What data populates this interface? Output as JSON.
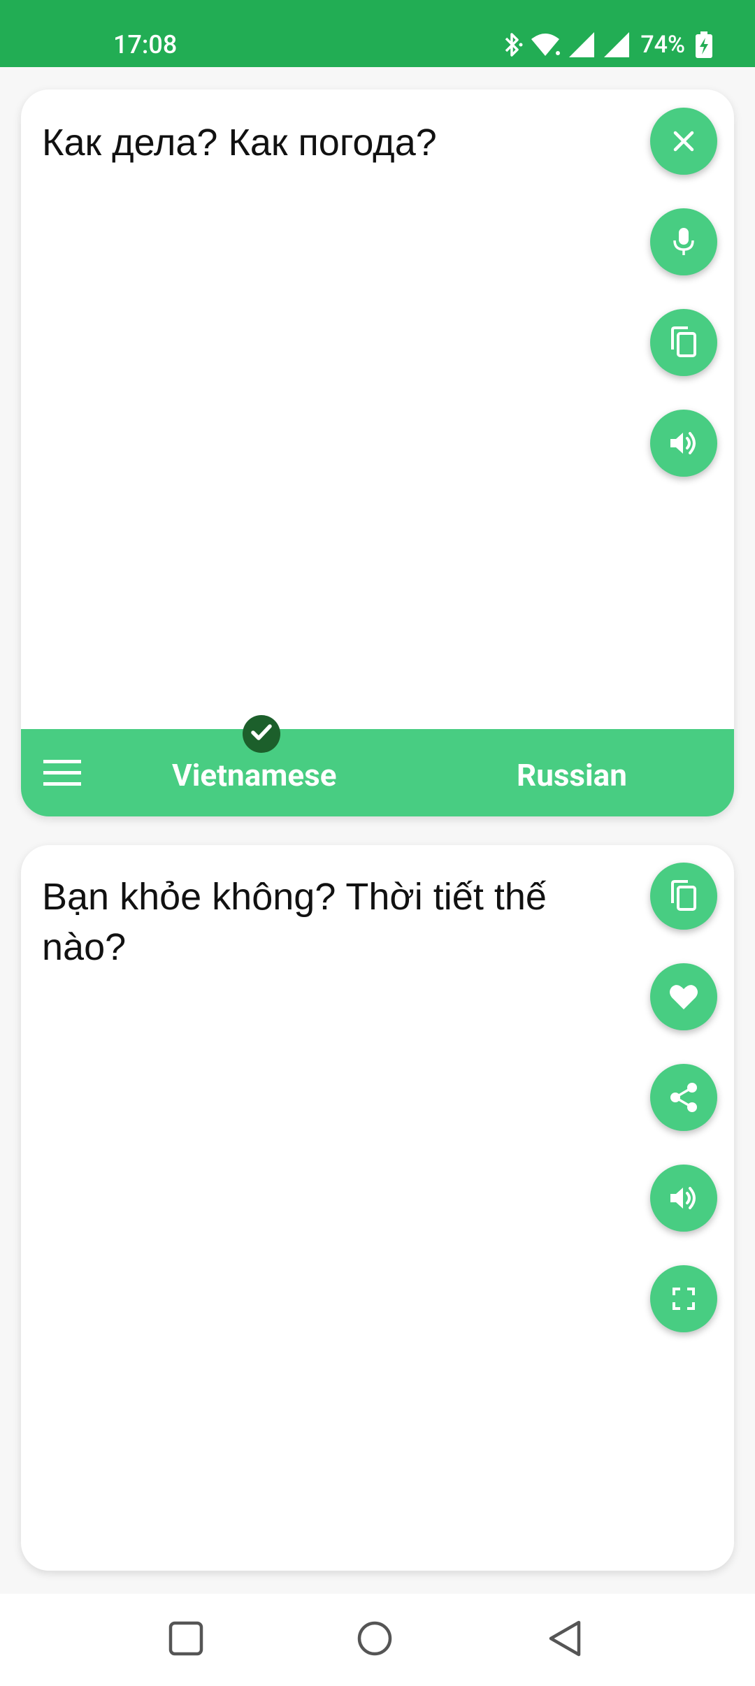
{
  "status_bar": {
    "time": "17:08",
    "battery_percent": "74%",
    "icons": [
      "bluetooth-icon",
      "wifi-icon",
      "signal-icon",
      "signal-icon",
      "battery-charging-icon"
    ]
  },
  "source_panel": {
    "text": "Как дела? Как погода?",
    "actions": [
      "clear-icon",
      "mic-icon",
      "copy-icon",
      "speaker-icon"
    ]
  },
  "language_bar": {
    "source_language": "Vietnamese",
    "target_language": "Russian",
    "selected": "Vietnamese"
  },
  "translation_panel": {
    "text": "Bạn khỏe không? Thời tiết thế nào?",
    "actions": [
      "copy-icon",
      "heart-icon",
      "share-icon",
      "speaker-icon",
      "fullscreen-icon"
    ]
  },
  "nav_bar": {
    "buttons": [
      "recents-icon",
      "home-icon",
      "back-icon"
    ]
  },
  "colors": {
    "status_bar": "#22ad54",
    "accent": "#48cd82",
    "check_badge": "#1c5f2b",
    "background": "#f7f7f7"
  }
}
